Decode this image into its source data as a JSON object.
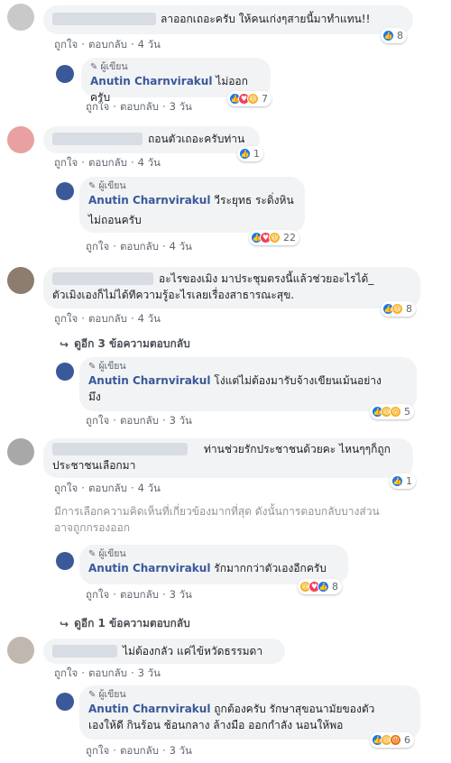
{
  "ui": {
    "like": "ถูกใจ",
    "reply": "ตอบกลับ",
    "author_tag": "ผู้เขียน",
    "author_name": "Anutin Charnvirakul",
    "pencil_glyph": "✎"
  },
  "comments": [
    {
      "text": "ลาออกเถอะครับ ให้คนเก่งๆสายนี้มาทำแทน!!",
      "time": "4 วัน",
      "reactions": {
        "icons": [
          "like-icon"
        ],
        "count": "8"
      },
      "reply": {
        "lines": [
          "ไม่ออกครับ"
        ],
        "time": "3 วัน",
        "reactions": {
          "icons": [
            "like-icon",
            "love-icon",
            "haha-icon"
          ],
          "count": "7"
        }
      }
    },
    {
      "text": "ถอนตัวเถอะครับท่าน",
      "time": "4 วัน",
      "reactions": {
        "icons": [
          "like-icon"
        ],
        "count": "1"
      },
      "reply": {
        "lines": [
          "วีระยุทธ ระดิ่งหิน",
          "ไม่ถอนครับ"
        ],
        "time": "4 วัน",
        "reactions": {
          "icons": [
            "like-icon",
            "love-icon",
            "haha-icon"
          ],
          "count": "22"
        }
      }
    },
    {
      "text_lines": [
        "อะไรของเมิง มาประชุมตรงนี้แล้วช่วยอะไรได้_",
        "ตัวเมิงเองก็ไม่ได้ทีความรู้อะไรเลยเรื่องสาธารณะสุข."
      ],
      "time": "4 วัน",
      "reactions": {
        "icons": [
          "like-icon",
          "haha-icon"
        ],
        "count": "8"
      },
      "more": "ดูอีก 3 ข้อความตอบกลับ",
      "reply": {
        "lines": [
          "โง่แต่ไม่ต้องมารับจ้างเขียนเม้นอย่าง",
          "มึง"
        ],
        "time": "3 วัน",
        "reactions": {
          "icons": [
            "like-icon",
            "haha-icon",
            "wow-icon"
          ],
          "count": "5"
        }
      }
    },
    {
      "text_lines": [
        "ท่านช่วยรักประชาชนด้วยคะ ไหนๆๆก็ถูก",
        "ประชาชนเลือกมา"
      ],
      "time": "4 วัน",
      "reactions": {
        "icons": [
          "like-icon"
        ],
        "count": "1"
      },
      "notice": [
        "มีการเลือกความคิดเห็นที่เกี่ยวข้องมากที่สุด ดังนั้นการตอบกลับบางส่วน",
        "อาจถูกกรองออก"
      ],
      "more": "ดูอีก 1 ข้อความตอบกลับ",
      "reply": {
        "lines": [
          "รักมากกว่าตัวเองอีกครับ"
        ],
        "time": "3 วัน",
        "reactions": {
          "icons": [
            "haha-icon",
            "love-icon",
            "like-icon"
          ],
          "count": "8"
        }
      }
    },
    {
      "text": "ไม่ต้องกลัว แค่ไข้หวัดธรรมดา",
      "time": "3 วัน",
      "reply": {
        "lines": [
          "ถูกต้องครับ รักษาสุขอนามัยของตัว",
          "เองให้ดี กินร้อน ช้อนกลาง ล้างมือ ออกกำลัง นอนให้พอ"
        ],
        "time": "3 วัน",
        "reactions": {
          "icons": [
            "like-icon",
            "haha-icon",
            "angry-icon"
          ],
          "count": "6"
        }
      }
    }
  ],
  "colors": {
    "link": "#385898",
    "bubble": "#f2f3f5",
    "meta": "#606770",
    "like": "#1877f2"
  }
}
